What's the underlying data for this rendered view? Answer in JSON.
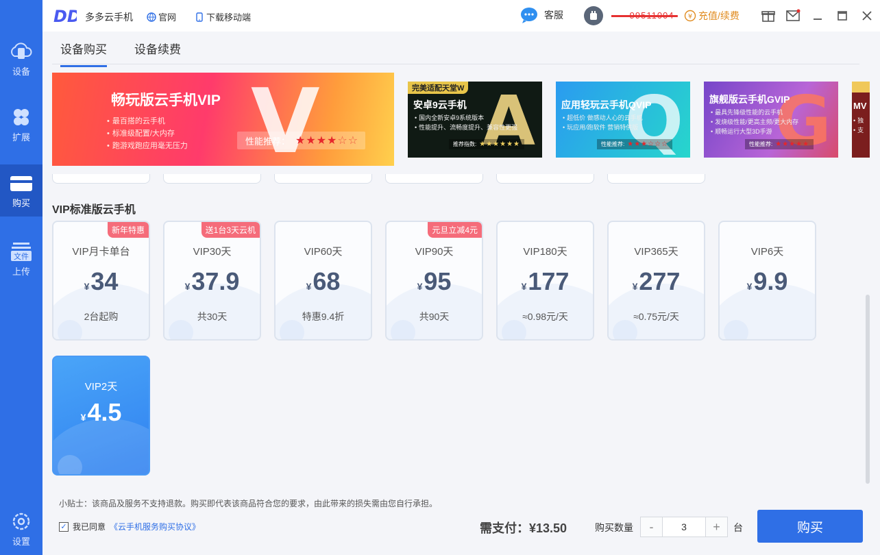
{
  "colors": {
    "sidebar": "#2f6fe6",
    "sidebar_active": "#2257c4",
    "accent": "#2f6fe6",
    "badge": "#f56c7a",
    "recharge": "#e08b1f"
  },
  "sidebar": {
    "items": [
      {
        "label": "设备",
        "icon": "cloud-phone-icon"
      },
      {
        "label": "扩展",
        "icon": "clover-icon"
      },
      {
        "label": "购买",
        "icon": "card-icon"
      },
      {
        "label": "上传",
        "icon": "file-upload-icon",
        "icon_text": "文件"
      },
      {
        "label": "设置",
        "icon": "gear-icon"
      }
    ]
  },
  "header": {
    "logo_text": "DD",
    "app_name": "多多云手机",
    "official_site": "官网",
    "download_mobile": "下载移动端",
    "service": "客服",
    "user_name": "-----99511004-",
    "recharge": "充值/续费",
    "recharge_icon_text": "¥"
  },
  "tabs": [
    {
      "label": "设备购买",
      "active": true
    },
    {
      "label": "设备续费",
      "active": false
    }
  ],
  "banners": {
    "main": {
      "title": "畅玩版云手机VIP",
      "letter": "V",
      "features": [
        "最百搭的云手机",
        "标准级配置/大内存",
        "跑游戏跑应用毫无压力"
      ],
      "rating_label": "性能推荐：",
      "stars_on": "★★★★",
      "stars_off": "☆☆"
    },
    "a": {
      "tag": "完美适配天堂W",
      "title": "安卓9云手机",
      "letter": "A",
      "features": [
        "国内全新安卓9系统版本",
        "性能提升、流畅度提升、兼容性更强"
      ],
      "rating_label": "推荐指数:",
      "stars": "★★★★★★"
    },
    "q": {
      "title": "应用轻玩云手机QVIP",
      "letter": "Q",
      "features": [
        "超低价 做感动人心的云手机",
        "玩应用/跑软件 营销特供版"
      ],
      "rating_label": "性能推荐:",
      "stars": "★★★☆☆☆"
    },
    "g": {
      "title": "旗舰版云手机GVIP",
      "letter": "G",
      "features": [
        "最具先锋级性能的云手机",
        "发烧级性能/更高主频/更大内存",
        "顺畅运行大型3D手游"
      ],
      "rating_label": "性能推荐:",
      "stars": "★★★★★"
    },
    "m": {
      "title": "MV",
      "features": [
        "独",
        "支"
      ]
    }
  },
  "section_title": "VIP标准版云手机",
  "cards": [
    {
      "name": "VIP月卡单台",
      "yen": "¥",
      "price": "34",
      "desc": "2台起购",
      "badge": "新年特惠"
    },
    {
      "name": "VIP30天",
      "yen": "¥",
      "price": "37.9",
      "desc": "共30天",
      "badge": "送1台3天云机"
    },
    {
      "name": "VIP60天",
      "yen": "¥",
      "price": "68",
      "desc": "特惠9.4折",
      "badge": ""
    },
    {
      "name": "VIP90天",
      "yen": "¥",
      "price": "95",
      "desc": "共90天",
      "badge": "元旦立减4元"
    },
    {
      "name": "VIP180天",
      "yen": "¥",
      "price": "177",
      "desc": "≈0.98元/天",
      "badge": ""
    },
    {
      "name": "VIP365天",
      "yen": "¥",
      "price": "277",
      "desc": "≈0.75元/天",
      "badge": ""
    },
    {
      "name": "VIP6天",
      "yen": "¥",
      "price": "9.9",
      "desc": "",
      "badge": ""
    },
    {
      "name": "VIP2天",
      "yen": "¥",
      "price": "4.5",
      "desc": "",
      "badge": "",
      "selected": true
    }
  ],
  "footer": {
    "tip": "小贴士：该商品及服务不支持退款。购买即代表该商品符合您的要求，由此带来的损失需由您自行承担。",
    "agree_prefix": "我已同意",
    "agree_link": "《云手机服务购买协议》",
    "pay_label": "需支付：¥13.50",
    "qty_label": "购买数量",
    "qty_minus": "-",
    "qty_plus": "+",
    "qty_value": "3",
    "unit": "台",
    "buy_label": "购买"
  }
}
